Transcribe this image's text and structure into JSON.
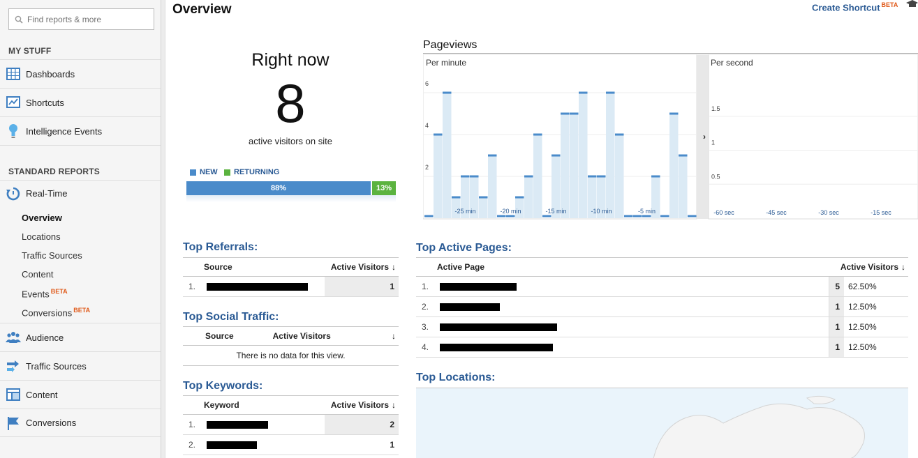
{
  "sidebar": {
    "search_placeholder": "Find reports & more",
    "my_stuff_title": "MY STUFF",
    "my_stuff": [
      {
        "label": "Dashboards",
        "icon": "dashboards-icon"
      },
      {
        "label": "Shortcuts",
        "icon": "shortcuts-icon"
      },
      {
        "label": "Intelligence Events",
        "icon": "intelligence-icon"
      }
    ],
    "standard_reports_title": "STANDARD REPORTS",
    "realtime_label": "Real-Time",
    "realtime_items": [
      {
        "label": "Overview",
        "active": true
      },
      {
        "label": "Locations"
      },
      {
        "label": "Traffic Sources"
      },
      {
        "label": "Content"
      },
      {
        "label": "Events",
        "beta": "BETA"
      },
      {
        "label": "Conversions",
        "beta": "BETA"
      }
    ],
    "reports": [
      {
        "label": "Audience",
        "icon": "audience-icon"
      },
      {
        "label": "Traffic Sources",
        "icon": "traffic-sources-icon"
      },
      {
        "label": "Content",
        "icon": "content-icon"
      },
      {
        "label": "Conversions",
        "icon": "conversions-icon"
      }
    ]
  },
  "header": {
    "title": "Overview",
    "create_shortcut": "Create Shortcut",
    "beta": "BETA"
  },
  "right_now": {
    "title": "Right now",
    "count": "8",
    "subtitle": "active visitors on site",
    "legend_new": "NEW",
    "legend_returning": "RETURNING",
    "new_pct_label": "88%",
    "returning_pct_label": "13%",
    "new_fraction": 0.88,
    "colors": {
      "new": "#4a8bca",
      "returning": "#5bb33f"
    }
  },
  "pageviews": {
    "title": "Pageviews",
    "per_minute_label": "Per minute",
    "per_second_label": "Per second",
    "expand_arrow": "›"
  },
  "chart_data": [
    {
      "type": "bar",
      "title": "Per minute",
      "ylim": [
        0,
        6.5
      ],
      "y_ticks": [
        2,
        4,
        6
      ],
      "x_ticks": [
        "-25 min",
        "-20 min",
        "-15 min",
        "-10 min",
        "-5 min"
      ],
      "values": [
        0,
        4,
        6,
        1,
        2,
        2,
        1,
        3,
        0,
        0,
        1,
        2,
        4,
        0,
        3,
        5,
        5,
        6,
        2,
        2,
        6,
        4,
        0,
        0,
        0,
        2,
        0,
        5,
        3,
        0
      ]
    },
    {
      "type": "bar",
      "title": "Per second",
      "ylim": [
        0,
        2
      ],
      "y_ticks": [
        0.5,
        1,
        1.5
      ],
      "x_ticks": [
        "-60 sec",
        "-45 sec",
        "-30 sec",
        "-15 sec"
      ],
      "values": []
    }
  ],
  "top_referrals": {
    "title": "Top Referrals:",
    "col_source": "Source",
    "col_visitors": "Active Visitors",
    "rows": [
      {
        "num": "1.",
        "value": "1",
        "redact": 145
      }
    ]
  },
  "top_social": {
    "title": "Top Social Traffic:",
    "col_source": "Source",
    "col_visitors": "Active Visitors",
    "no_data": "There is no data for this view."
  },
  "top_keywords": {
    "title": "Top Keywords:",
    "col_keyword": "Keyword",
    "col_visitors": "Active Visitors",
    "rows": [
      {
        "num": "1.",
        "value": "2",
        "redact": 88
      },
      {
        "num": "2.",
        "value": "1",
        "redact": 72
      }
    ]
  },
  "top_pages": {
    "title": "Top Active Pages:",
    "col_page": "Active Page",
    "col_visitors": "Active Visitors",
    "rows": [
      {
        "num": "1.",
        "value": "5",
        "pct": "62.50%",
        "redact": 110
      },
      {
        "num": "2.",
        "value": "1",
        "pct": "12.50%",
        "redact": 86
      },
      {
        "num": "3.",
        "value": "1",
        "pct": "12.50%",
        "redact": 168
      },
      {
        "num": "4.",
        "value": "1",
        "pct": "12.50%",
        "redact": 162
      }
    ]
  },
  "top_locations": {
    "title": "Top Locations:"
  }
}
